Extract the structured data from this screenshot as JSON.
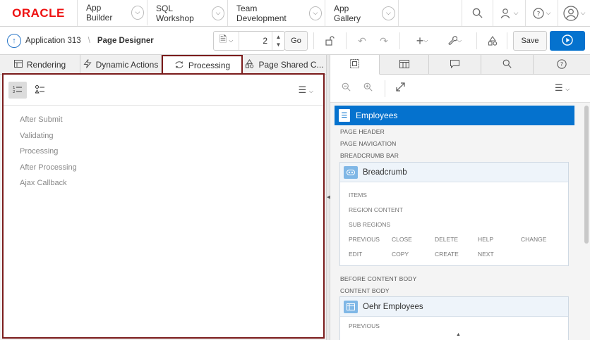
{
  "brand": {
    "logo_text": "ORACLE"
  },
  "top_nav": {
    "tabs": [
      {
        "label": "App Builder"
      },
      {
        "label": "SQL Workshop"
      },
      {
        "label": "Team Development"
      },
      {
        "label": "App Gallery"
      }
    ],
    "icons": [
      "search-icon",
      "user-settings-icon",
      "help-icon",
      "user-avatar-icon"
    ]
  },
  "toolbar": {
    "application": "Application 313",
    "separator": "\\",
    "page_designer": "Page Designer",
    "page_number": "2",
    "go_label": "Go",
    "save_label": "Save"
  },
  "left_tabs": [
    {
      "label": "Rendering",
      "icon": "table-icon"
    },
    {
      "label": "Dynamic Actions",
      "icon": "lightning-icon"
    },
    {
      "label": "Processing",
      "icon": "process-cycle-icon"
    },
    {
      "label": "Page Shared C...",
      "icon": "shapes-icon"
    }
  ],
  "processing_points": [
    "After Submit",
    "Validating",
    "Processing",
    "After Processing",
    "Ajax Callback"
  ],
  "layout": {
    "page_title": "Employees",
    "labels": {
      "page_header": "PAGE HEADER",
      "page_navigation": "PAGE NAVIGATION",
      "breadcrumb_bar": "BREADCRUMB BAR",
      "before_content_body": "BEFORE CONTENT BODY",
      "content_body": "CONTENT BODY"
    },
    "breadcrumb_region": {
      "title": "Breadcrumb",
      "items": "ITEMS",
      "region_content": "REGION CONTENT",
      "sub_regions": "SUB REGIONS",
      "buttons_row1": [
        "PREVIOUS",
        "CLOSE",
        "DELETE",
        "HELP",
        "CHANGE"
      ],
      "buttons_row2": [
        "EDIT",
        "COPY",
        "CREATE",
        "NEXT"
      ]
    },
    "employees_region": {
      "title": "Oehr Employees",
      "first_label": "PREVIOUS"
    }
  },
  "colors": {
    "accent": "#0572ce",
    "highlight_border": "#7b1c1c",
    "oracle_red": "#ee1111"
  }
}
